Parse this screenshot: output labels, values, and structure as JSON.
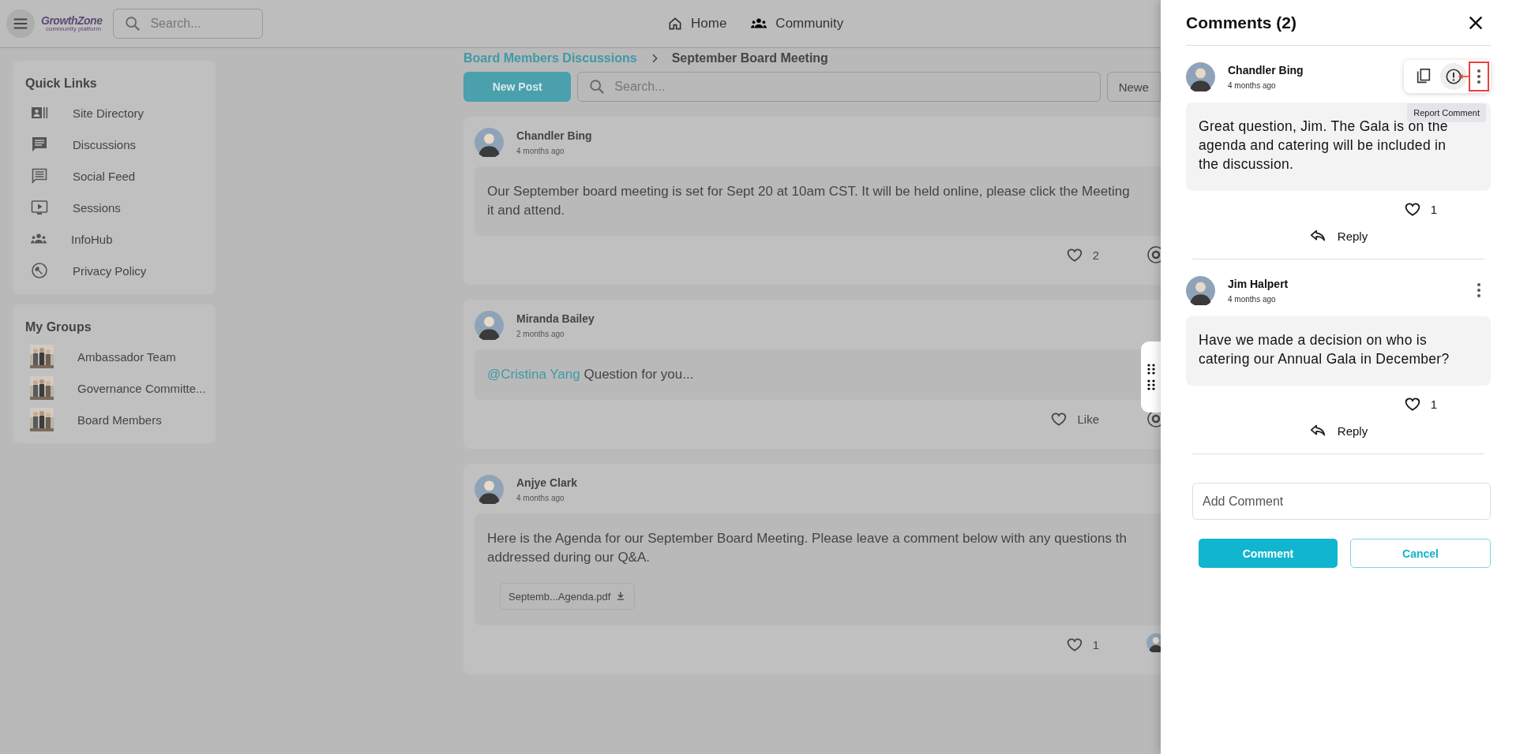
{
  "header": {
    "logo_text": "GrowthZone",
    "logo_subtext": "community platform",
    "search": {
      "placeholder": "Search..."
    },
    "nav": [
      {
        "label": "Home",
        "kind": "home"
      },
      {
        "label": "Community",
        "kind": "people"
      }
    ]
  },
  "sidebar": {
    "quick_links": {
      "title": "Quick Links",
      "items": [
        {
          "label": "Site Directory",
          "kind": "directory"
        },
        {
          "label": "Discussions",
          "kind": "chat"
        },
        {
          "label": "Social Feed",
          "kind": "feed"
        },
        {
          "label": "Sessions",
          "kind": "video"
        },
        {
          "label": "InfoHub",
          "kind": "people"
        },
        {
          "label": "Privacy Policy",
          "kind": "wrench"
        }
      ]
    },
    "my_groups": {
      "title": "My Groups",
      "items": [
        {
          "label": "Ambassador Team",
          "kind": "picture"
        },
        {
          "label": "Governance Committe...",
          "kind": "picture"
        },
        {
          "label": "Board Members",
          "kind": "picture"
        }
      ]
    }
  },
  "breadcrumb": {
    "parent": "Board Members Discussions",
    "current": "September Board Meeting"
  },
  "toolbar": {
    "new_post": "New Post",
    "search": {
      "placeholder": "Search..."
    },
    "sort": "Newe"
  },
  "posts": [
    {
      "author": "Chandler Bing",
      "time": "4 months ago",
      "body_lines": [
        "Our September board meeting is set for Sept 20 at 10am CST. It will be held online, please click the Meeting",
        "it and attend."
      ],
      "likes": "2",
      "kind": "circle"
    },
    {
      "author": "Miranda Bailey",
      "time": "2 months ago",
      "mention": "@Cristina Yang",
      "body_lines": [
        "Question for you..."
      ],
      "likes": "Like",
      "kind": "circle"
    },
    {
      "author": "Anjye Clark",
      "time": "4 months ago",
      "body_lines": [
        "Here is the Agenda for our September Board Meeting. Please leave a comment below with any questions  th",
        "addressed during our Q&A."
      ],
      "attachment": "Septemb...Agenda.pdf",
      "likes": "1",
      "kind": "avatar"
    }
  ],
  "drawer": {
    "title": "Comments (2)",
    "comments": [
      {
        "author": "Chandler Bing",
        "time": "4 months ago",
        "body": "Great question, Jim. The Gala is on the agenda and catering will be included in the discussion.",
        "likes": "1",
        "reply": "Reply",
        "menu_open": true,
        "tooltip": "Report Comment",
        "annotated": true
      },
      {
        "author": "Jim Halpert",
        "time": "4 months ago",
        "body": "Have we made a decision on who is catering our Annual Gala in December?",
        "likes": "1",
        "reply": "Reply",
        "menu_open": false
      }
    ],
    "add_comment": {
      "placeholder": "Add Comment"
    },
    "buttons": [
      {
        "label": "Comment",
        "kind": "primary"
      },
      {
        "label": "Cancel",
        "kind": "secondary"
      }
    ]
  }
}
